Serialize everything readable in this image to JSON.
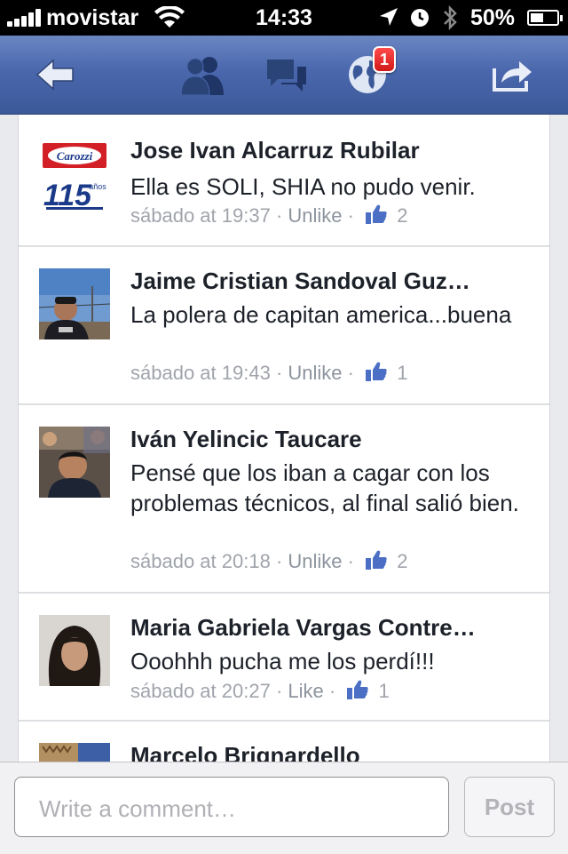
{
  "status_bar": {
    "carrier": "movistar",
    "time": "14:33",
    "battery": "50%"
  },
  "nav": {
    "notifications_badge": "1",
    "icons": [
      "back-arrow-icon",
      "friends-icon",
      "messages-icon",
      "notifications-globe-icon",
      "share-icon"
    ],
    "color": "#3b5998"
  },
  "comments": [
    {
      "name": "Jose Ivan Alcarruz Rubilar",
      "text": "Ella es SOLI, SHIA no pudo venir.",
      "time": "sábado at 19:37",
      "action": "Unlike",
      "likes": "2",
      "avatar_text": [
        "Carozzi",
        "115",
        "años"
      ]
    },
    {
      "name": "Jaime Cristian Sandoval Guz…",
      "text": "La polera de capitan america...buena",
      "time": "sábado at 19:43",
      "action": "Unlike",
      "likes": "1"
    },
    {
      "name": "Iván Yelincic Taucare",
      "text": "Pensé que los iban a cagar con los problemas técnicos, al final salió bien.",
      "time": "sábado at 20:18",
      "action": "Unlike",
      "likes": "2"
    },
    {
      "name": "Maria Gabriela Vargas Contre…",
      "text": "Ooohhh pucha me los perdí!!!",
      "time": "sábado at 20:27",
      "action": "Like",
      "likes": "1"
    },
    {
      "name": "Marcelo Brignardello"
    }
  ],
  "composer": {
    "placeholder": "Write a comment…",
    "post_label": "Post"
  },
  "separator": "·"
}
